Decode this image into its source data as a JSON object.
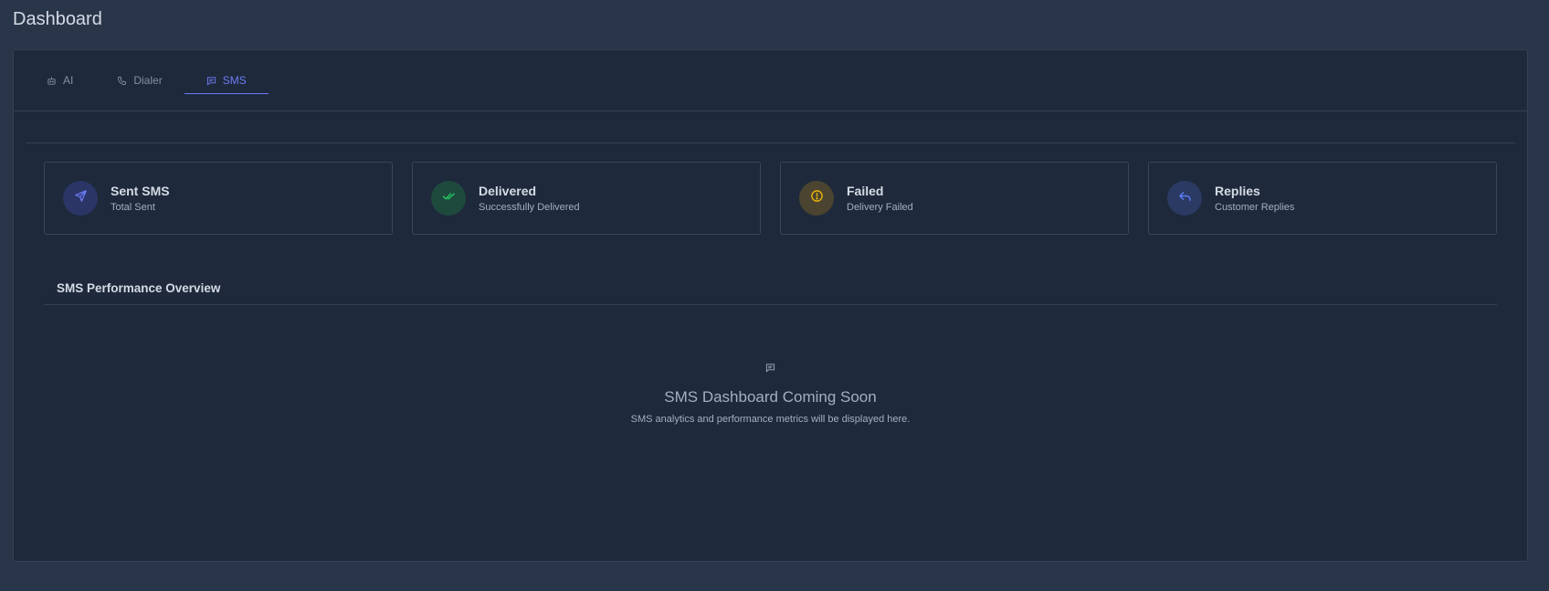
{
  "page": {
    "title": "Dashboard"
  },
  "tabs": [
    {
      "label": "AI",
      "icon": "robot-icon",
      "active": false
    },
    {
      "label": "Dialer",
      "icon": "phone-icon",
      "active": false
    },
    {
      "label": "SMS",
      "icon": "message-icon",
      "active": true
    }
  ],
  "stats": [
    {
      "title": "Sent SMS",
      "subtitle": "Total Sent",
      "icon": "send-icon",
      "color": "#6d7cf7",
      "bg": "#2b3566"
    },
    {
      "title": "Delivered",
      "subtitle": "Successfully Delivered",
      "icon": "check-double-icon",
      "color": "#22c55e",
      "bg": "#1e4a3e"
    },
    {
      "title": "Failed",
      "subtitle": "Delivery Failed",
      "icon": "alert-circle-icon",
      "color": "#eab308",
      "bg": "#4a4430"
    },
    {
      "title": "Replies",
      "subtitle": "Customer Replies",
      "icon": "reply-icon",
      "color": "#5b7ef5",
      "bg": "#2a3a63"
    }
  ],
  "section": {
    "title": "SMS Performance Overview"
  },
  "empty_state": {
    "icon": "message-icon",
    "heading": "SMS Dashboard Coming Soon",
    "description": "SMS analytics and performance metrics will be displayed here."
  }
}
